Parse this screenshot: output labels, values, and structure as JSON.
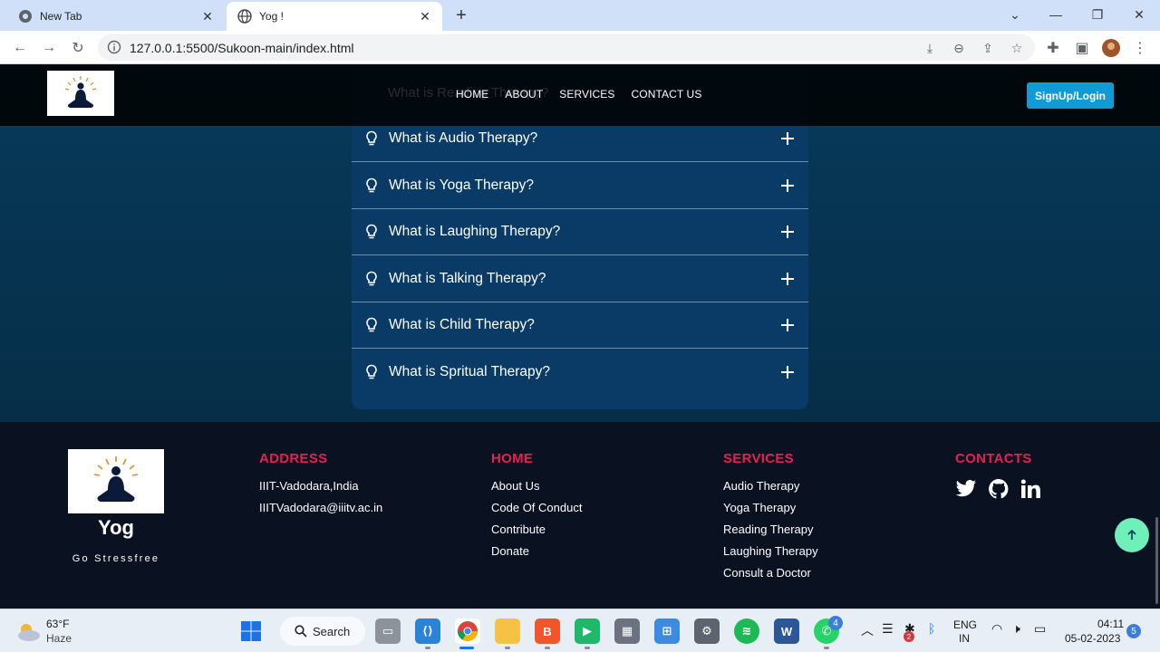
{
  "browser": {
    "tabs": [
      {
        "title": "New Tab",
        "active": false
      },
      {
        "title": "Yog !",
        "active": true
      }
    ],
    "url": "127.0.0.1:5500/Sukoon-main/index.html"
  },
  "header": {
    "nav": [
      "HOME",
      "ABOUT",
      "SERVICES",
      "CONTACT US"
    ],
    "signup_label": "SignUp/Login",
    "faded_question": "What is Reading Therapy?"
  },
  "faq": [
    "What is Audio Therapy?",
    "What is Yoga Therapy?",
    "What is Laughing Therapy?",
    "What is Talking Therapy?",
    "What is Child Therapy?",
    "What is Spritual Therapy?"
  ],
  "footer": {
    "brand": "Yog",
    "tagline": "Go Stressfree",
    "address": {
      "heading": "ADDRESS",
      "lines": [
        "IIIT-Vadodara,India",
        "IIITVadodara@iiitv.ac.in"
      ]
    },
    "home": {
      "heading": "HOME",
      "links": [
        "About Us",
        "Code Of Conduct",
        "Contribute",
        "Donate"
      ]
    },
    "services": {
      "heading": "SERVICES",
      "links": [
        "Audio Therapy",
        "Yoga Therapy",
        "Reading Therapy",
        "Laughing Therapy",
        "Consult a Doctor"
      ]
    },
    "contacts": {
      "heading": "CONTACTS",
      "icons": [
        "twitter-icon",
        "github-icon",
        "linkedin-icon"
      ]
    }
  },
  "taskbar": {
    "weather_temp": "63°F",
    "weather_desc": "Haze",
    "search_label": "Search",
    "lang_top": "ENG",
    "lang_bottom": "IN",
    "time": "04:11",
    "date": "05-02-2023",
    "notification_count": "5",
    "whatsapp_badge": "4",
    "tray_badge": "2"
  },
  "colors": {
    "accent_red": "#e8204f",
    "signup_blue": "#119bd6",
    "faq_bg": "#0a3b66",
    "footer_bg": "#0a1121",
    "to_top": "#6ef0b8"
  }
}
